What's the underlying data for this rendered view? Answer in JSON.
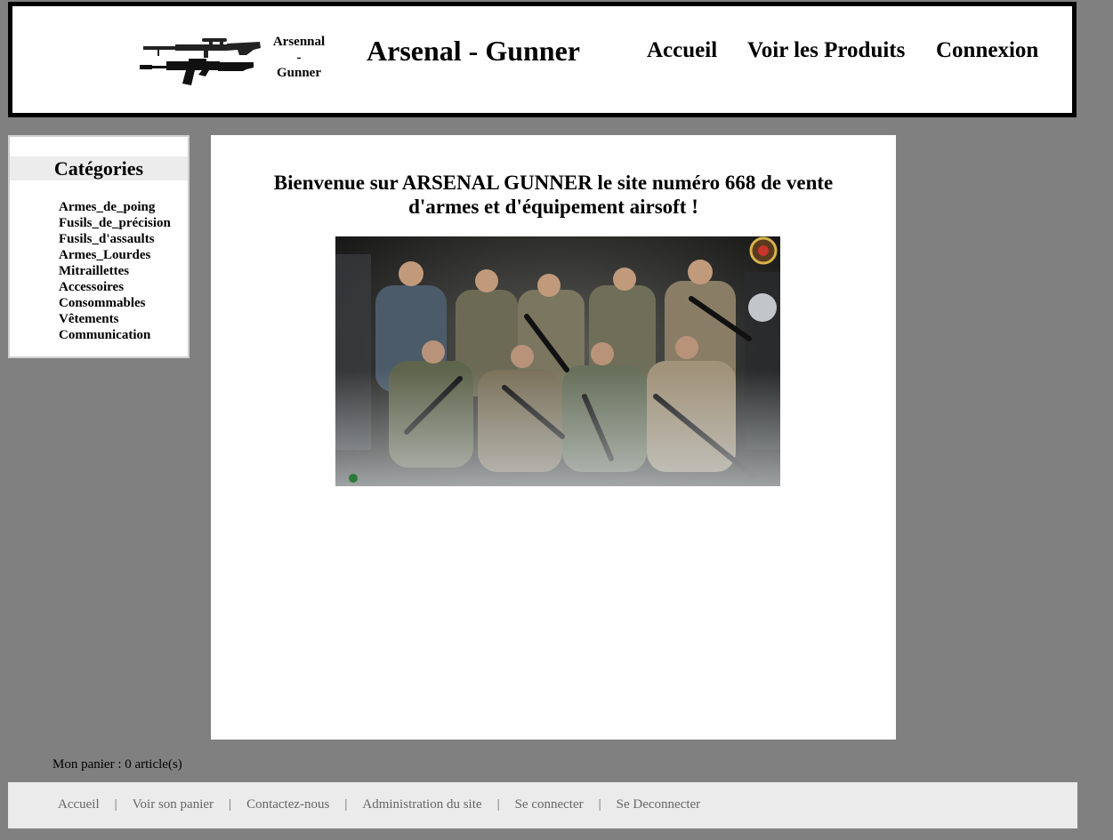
{
  "header": {
    "logo_lines": [
      "Arsennal",
      "-",
      "Gunner"
    ],
    "title": "Arsenal - Gunner",
    "nav": [
      "Accueil",
      "Voir les Produits",
      "Connexion"
    ]
  },
  "sidebar": {
    "title": "Catégories",
    "items": [
      "Armes_de_poing",
      "Fusils_de_précision",
      "Fusils_d'assaults",
      "Armes_Lourdes",
      "Mitraillettes",
      "Accessoires",
      "Consommables",
      "Vêtements",
      "Communication"
    ]
  },
  "main": {
    "welcome_line1": "Bienvenue sur ARSENAL GUNNER le site numéro 668 de vente",
    "welcome_line2": "d'armes et d'équipement airsoft !"
  },
  "cart": {
    "text": "Mon panier : 0 article(s)"
  },
  "footer": {
    "links": [
      "Accueil",
      "Voir son panier",
      "Contactez-nous",
      "Administration du site",
      "Se connecter",
      "Se Deconnecter"
    ],
    "separator": "|"
  },
  "colors": {
    "page_background": "#808080",
    "panel_background": "#ffffff",
    "header_border": "#000000",
    "footer_background": "#ebebeb",
    "footer_text": "#666666"
  }
}
